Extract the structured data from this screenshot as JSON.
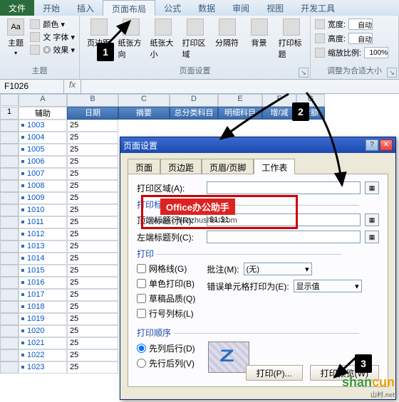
{
  "tabs": {
    "file": "文件",
    "items": [
      "开始",
      "插入",
      "页面布局",
      "公式",
      "数据",
      "审阅",
      "视图",
      "开发工具"
    ],
    "active_index": 2
  },
  "ribbon": {
    "theme_group": {
      "big": "主题",
      "items": [
        "颜色 ▾",
        "文 字体 ▾",
        "◎ 效果 ▾"
      ],
      "title": "主题"
    },
    "page_setup_group": {
      "items": [
        "页边距",
        "纸张方向",
        "纸张大小",
        "打印区域",
        "分隔符",
        "背景",
        "打印标题"
      ],
      "title": "页面设置"
    },
    "scale_group": {
      "width_label": "宽度:",
      "width_val": "自动",
      "height_label": "高度:",
      "height_val": "自动",
      "scale_label": "缩放比例:",
      "scale_val": "100%",
      "title": "调整为合适大小"
    }
  },
  "namebox": "F1026",
  "columns": [
    "A",
    "B",
    "C",
    "D",
    "E",
    "F",
    "G"
  ],
  "header_row": {
    "row_num": "1",
    "cells": [
      "辅助",
      "日期",
      "摘要",
      "总分类科目",
      "明细科目",
      "增/减",
      "金额"
    ]
  },
  "rows": [
    {
      "n": "",
      "a": "1003",
      "b": "25"
    },
    {
      "n": "",
      "a": "1004",
      "b": "25"
    },
    {
      "n": "",
      "a": "1005",
      "b": "25"
    },
    {
      "n": "",
      "a": "1006",
      "b": "25"
    },
    {
      "n": "",
      "a": "1007",
      "b": "25"
    },
    {
      "n": "",
      "a": "1008",
      "b": "25"
    },
    {
      "n": "",
      "a": "1009",
      "b": "25"
    },
    {
      "n": "",
      "a": "1010",
      "b": "25"
    },
    {
      "n": "",
      "a": "1011",
      "b": "25"
    },
    {
      "n": "",
      "a": "1012",
      "b": "25"
    },
    {
      "n": "",
      "a": "1013",
      "b": "25"
    },
    {
      "n": "",
      "a": "1014",
      "b": "25"
    },
    {
      "n": "",
      "a": "1015",
      "b": "25"
    },
    {
      "n": "",
      "a": "1016",
      "b": "25"
    },
    {
      "n": "",
      "a": "1017",
      "b": "25"
    },
    {
      "n": "",
      "a": "1018",
      "b": "25"
    },
    {
      "n": "",
      "a": "1019",
      "b": "25"
    },
    {
      "n": "",
      "a": "1020",
      "b": "25"
    },
    {
      "n": "",
      "a": "1021",
      "b": "25"
    },
    {
      "n": "",
      "a": "1022",
      "b": "25"
    },
    {
      "n": "",
      "a": "1023",
      "b": "25"
    }
  ],
  "dialog": {
    "title": "页面设置",
    "tabs": [
      "页面",
      "页边距",
      "页眉/页脚",
      "工作表"
    ],
    "active_tab": 3,
    "print_area_label": "打印区域(A):",
    "print_titles_label": "打印标题",
    "top_rows_label": "顶端标题行(R):",
    "top_rows_value": "$1:$1",
    "left_cols_label": "左端标题列(C):",
    "print_section": "打印",
    "gridlines": "网格线(G)",
    "bw": "单色打印(B)",
    "draft": "草稿品质(Q)",
    "rowcol": "行号列标(L)",
    "comments_label": "批注(M):",
    "comments_value": "(无)",
    "errors_label": "错误单元格打印为(E):",
    "errors_value": "显示值",
    "order_section": "打印顺序",
    "order_down": "先列后行(D)",
    "order_over": "先行后列(V)",
    "btn_print": "打印(P)...",
    "btn_preview": "打印预览(W)"
  },
  "annotations": {
    "b1": "1",
    "b2": "2",
    "b3": "3",
    "red_label": "Office办公助手",
    "red_sub": "www.officezhushou.com"
  },
  "watermark": {
    "t1": "shan",
    "t2": "cun",
    "sub": "山村.net"
  }
}
